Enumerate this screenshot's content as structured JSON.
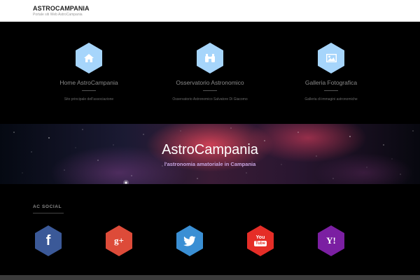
{
  "site": {
    "title": "ASTROCAMPANIA",
    "tagline": "Portale siti Web AstroCampania"
  },
  "features": [
    {
      "title": "Home AstroCampania",
      "description": "Sito principale dell'associazione",
      "icon": "home-icon"
    },
    {
      "title": "Osservatorio Astronomico",
      "description": "Osservatorio Astronomico Salvatore Di Giacomo",
      "icon": "binoculars-icon"
    },
    {
      "title": "Galleria Fotografica",
      "description": "Galleria di immagini astronomiche",
      "icon": "image-icon"
    }
  ],
  "banner": {
    "title": "AstroCampania",
    "subtitle": "l'astronomia amatoriale in Campania"
  },
  "social": {
    "heading": "AC SOCIAL",
    "items": [
      {
        "name": "facebook",
        "icon": "facebook-icon",
        "glyph": "f",
        "color": "#3b5998"
      },
      {
        "name": "google-plus",
        "icon": "google-plus-icon",
        "glyph": "g+",
        "color": "#dd4b39"
      },
      {
        "name": "twitter",
        "icon": "twitter-icon",
        "glyph": "",
        "color": "#3a8fd4"
      },
      {
        "name": "youtube",
        "icon": "youtube-icon",
        "glyph": "You",
        "color": "#e52d27"
      },
      {
        "name": "yahoo",
        "icon": "yahoo-icon",
        "glyph": "Y!",
        "color": "#7b1fa2"
      }
    ]
  }
}
